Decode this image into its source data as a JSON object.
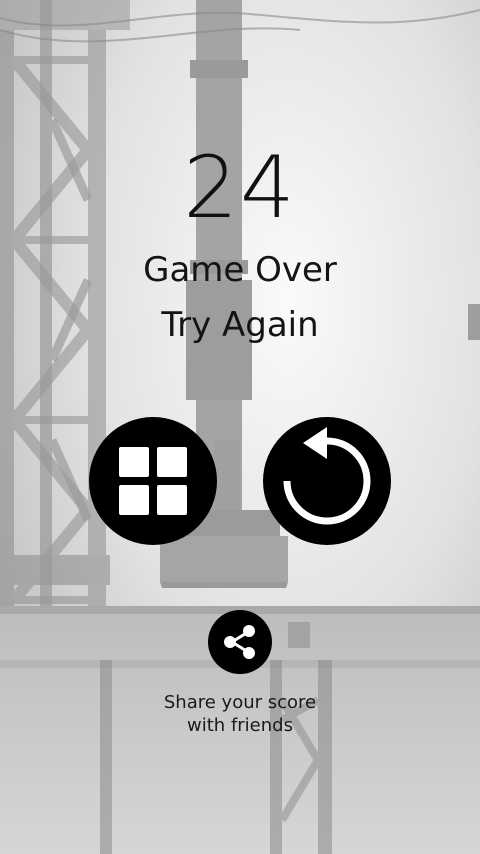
{
  "game": {
    "score": "24",
    "title_line1": "Game Over",
    "title_line2": "Try Again",
    "share_line1": "Share your score",
    "share_line2": "with friends"
  },
  "buttons": {
    "menu_icon": "grid-icon",
    "restart_icon": "restart-icon",
    "share_icon": "share-icon"
  },
  "colors": {
    "button_bg": "#000000",
    "background": "#e4e4e4",
    "text": "#111111"
  }
}
